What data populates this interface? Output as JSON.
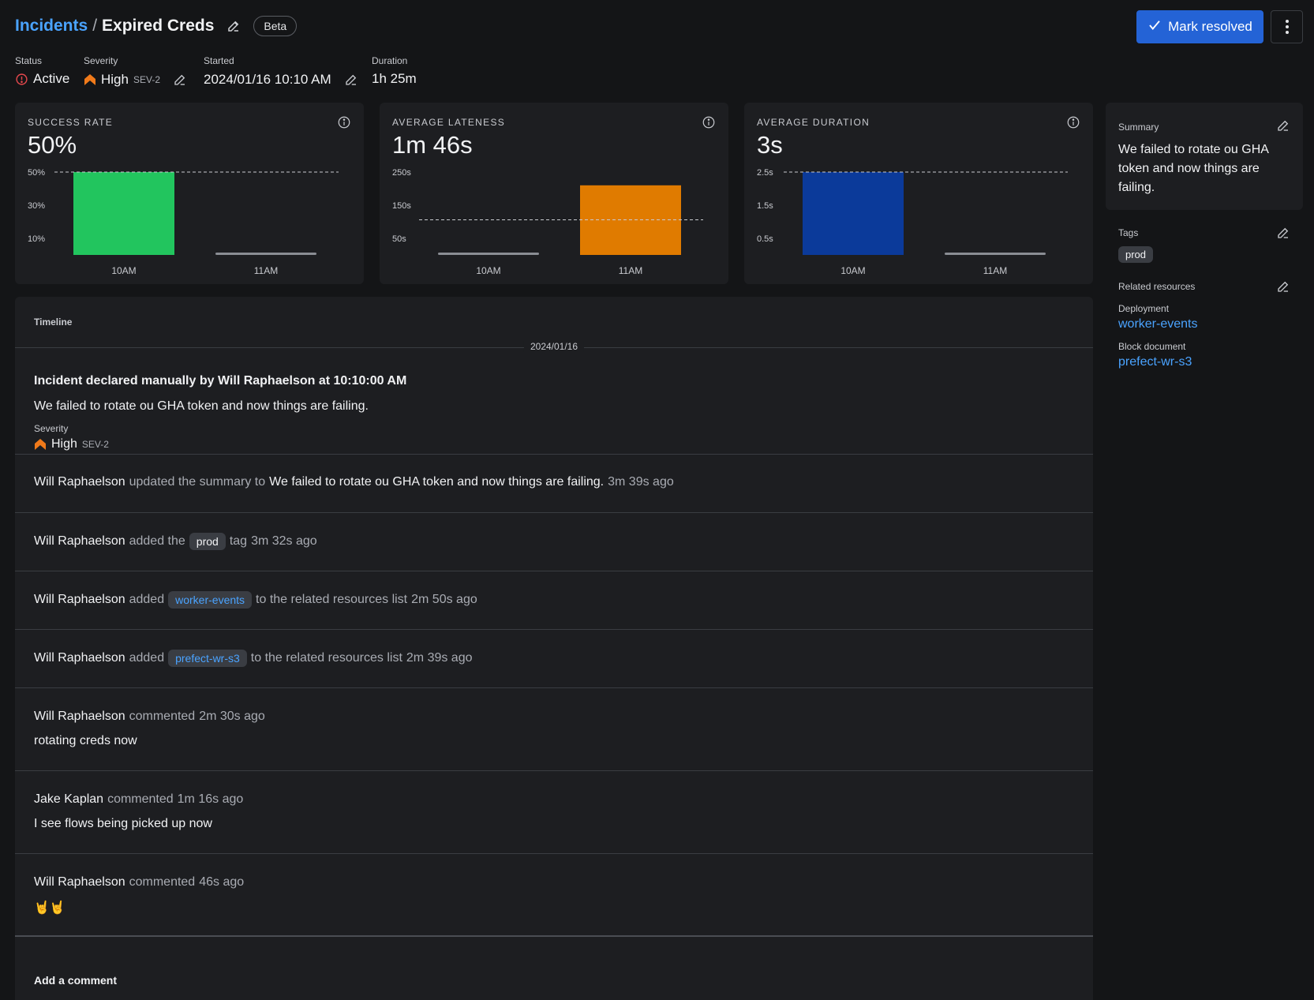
{
  "header": {
    "breadcrumb_root": "Incidents",
    "breadcrumb_sep": "/",
    "title": "Expired Creds",
    "beta_label": "Beta",
    "resolve_label": "Mark resolved"
  },
  "meta": {
    "status_label": "Status",
    "status_value": "Active",
    "severity_label": "Severity",
    "severity_value": "High",
    "severity_level": "SEV-2",
    "started_label": "Started",
    "started_value": "2024/01/16 10:10 AM",
    "duration_label": "Duration",
    "duration_value": "1h 25m"
  },
  "colors": {
    "accent": "#2463d6",
    "link": "#4aa3ff",
    "success": "#22c55e",
    "lateness": "#e07b00",
    "duration": "#0b3a9a",
    "severity_high": "#f07a1a",
    "status_active": "#e5484d"
  },
  "cards": [
    {
      "label": "SUCCESS RATE",
      "value": "50%"
    },
    {
      "label": "AVERAGE LATENESS",
      "value": "1m 46s"
    },
    {
      "label": "AVERAGE DURATION",
      "value": "3s"
    }
  ],
  "chart_data": [
    {
      "type": "bar",
      "categories": [
        "10AM",
        "11AM"
      ],
      "values": [
        50,
        0
      ],
      "yticks": [
        "50%",
        "30%",
        "10%"
      ],
      "ylim": [
        0,
        50
      ],
      "reference_line": 50,
      "color": "#22c55e"
    },
    {
      "type": "bar",
      "categories": [
        "10AM",
        "11AM"
      ],
      "values": [
        0,
        210
      ],
      "yticks": [
        "250s",
        "150s",
        "50s"
      ],
      "ylim": [
        0,
        250
      ],
      "reference_line": 106,
      "color": "#e07b00"
    },
    {
      "type": "bar",
      "categories": [
        "10AM",
        "11AM"
      ],
      "values": [
        3,
        0
      ],
      "yticks": [
        "2.5s",
        "1.5s",
        "0.5s"
      ],
      "ylim": [
        0,
        3
      ],
      "reference_line": 3,
      "color": "#0b3a9a"
    }
  ],
  "summary": {
    "label": "Summary",
    "text": "We failed to rotate ou GHA token and now things are failing."
  },
  "tags": {
    "label": "Tags",
    "items": [
      "prod"
    ]
  },
  "related": {
    "label": "Related resources",
    "items": [
      {
        "type": "Deployment",
        "name": "worker-events"
      },
      {
        "type": "Block document",
        "name": "prefect-wr-s3"
      }
    ]
  },
  "timeline": {
    "title": "Timeline",
    "date": "2024/01/16",
    "declared": {
      "headline": "Incident declared manually by Will Raphaelson at 10:10:00 AM",
      "text": "We failed to rotate ou GHA token and now things are failing.",
      "severity_label": "Severity",
      "severity_value": "High",
      "severity_level": "SEV-2"
    },
    "events": [
      {
        "user": "Will Raphaelson",
        "action": "updated the summary to",
        "content": "We failed to rotate ou GHA token and now things are failing.",
        "time": "3m 39s ago"
      },
      {
        "user": "Will Raphaelson",
        "action": "added the",
        "chip": "prod",
        "after": "tag",
        "time": "3m 32s ago"
      },
      {
        "user": "Will Raphaelson",
        "action": "added",
        "chip": "worker-events",
        "after": "to the related resources list",
        "time": "2m 50s ago"
      },
      {
        "user": "Will Raphaelson",
        "action": "added",
        "chip": "prefect-wr-s3",
        "after": "to the related resources list",
        "time": "2m 39s ago"
      }
    ],
    "comments": [
      {
        "user": "Will Raphaelson",
        "action": "commented",
        "time": "2m 30s ago",
        "text": "rotating creds now"
      },
      {
        "user": "Jake Kaplan",
        "action": "commented",
        "time": "1m 16s ago",
        "text": "I see flows being picked up now"
      },
      {
        "user": "Will Raphaelson",
        "action": "commented",
        "time": "46s ago",
        "text": "🤘🤘"
      }
    ],
    "add_comment_label": "Add a comment"
  }
}
